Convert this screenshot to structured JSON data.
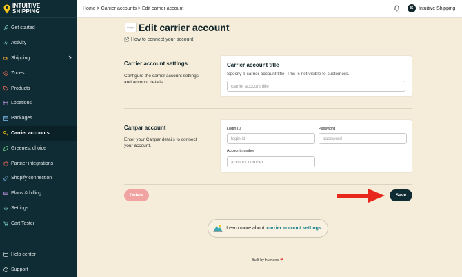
{
  "brand": {
    "line1": "INTUITIVE",
    "line2": "SHIPPING"
  },
  "sidebar": {
    "items": [
      {
        "label": "Get started",
        "icon": "rocket-icon"
      },
      {
        "label": "Activity",
        "icon": "activity-icon"
      },
      {
        "label": "Shipping",
        "icon": "truck-icon"
      },
      {
        "label": "Zones",
        "icon": "zones-icon"
      },
      {
        "label": "Products",
        "icon": "tag-icon"
      },
      {
        "label": "Locations",
        "icon": "store-icon"
      },
      {
        "label": "Packages",
        "icon": "box-icon"
      },
      {
        "label": "Carrier accounts",
        "icon": "key-icon",
        "active": true
      },
      {
        "label": "Greenest choice",
        "icon": "leaf-icon"
      },
      {
        "label": "Partner integrations",
        "icon": "puzzle-icon"
      },
      {
        "label": "Shopify connection",
        "icon": "link-icon"
      },
      {
        "label": "Plans & billing",
        "icon": "card-icon"
      },
      {
        "label": "Settings",
        "icon": "gear-icon"
      },
      {
        "label": "Cart Tester",
        "icon": "cart-icon"
      }
    ],
    "bottom": [
      {
        "label": "Help center",
        "icon": "book-icon"
      },
      {
        "label": "Support",
        "icon": "question-icon"
      }
    ]
  },
  "topbar": {
    "breadcrumb": "Home > Carrier accounts > Edit carrier account",
    "avatar_initials": "IS",
    "user_name": "Intuitive Shipping"
  },
  "page": {
    "carrier_logo_text": "Canpar",
    "title": "Edit carrier account",
    "help_link": "How to connect your account"
  },
  "settings_section": {
    "title": "Carrier account settings",
    "description": "Configure the carrier account settings and account details.",
    "card": {
      "title": "Carrier account title",
      "subtitle": "Specify a carrier account title. This is not visible to customers.",
      "placeholder": "carrier account title"
    }
  },
  "account_section": {
    "title": "Canpar account",
    "description": "Enter your Canpar details to connect your account.",
    "login_label": "Login ID",
    "login_placeholder": "login id",
    "password_label": "Password",
    "password_placeholder": "password",
    "account_label": "Account number",
    "account_placeholder": "account number"
  },
  "actions": {
    "delete_label": "Delete",
    "save_label": "Save"
  },
  "learn_more": {
    "text": "Learn more about",
    "link": "carrier account settings."
  },
  "footer": {
    "text": "Built by humans"
  },
  "colors": {
    "sidebar": "#0f2b33",
    "background": "#f5ecd9",
    "save": "#0f2b33",
    "delete": "#f0a3a0",
    "arrow": "#e8281b",
    "link": "#1a7f8c"
  }
}
